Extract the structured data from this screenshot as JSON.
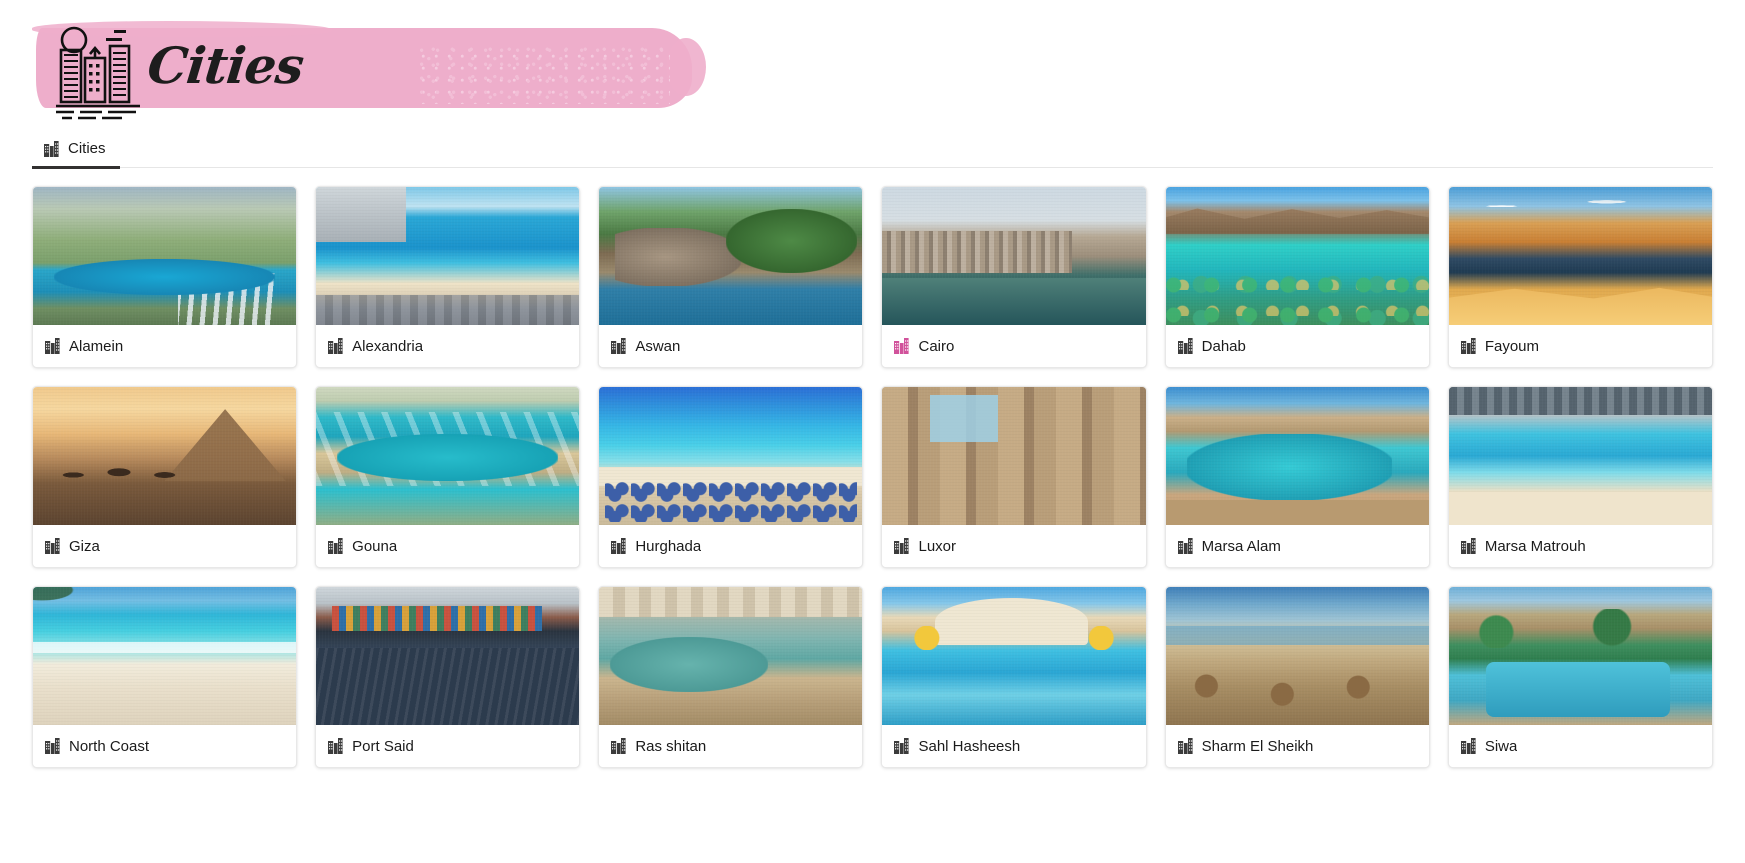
{
  "header": {
    "logo_text": "Cities",
    "logo_icon": "city-skyline-icon",
    "brush_color": "#eeaecb"
  },
  "tabs": [
    {
      "label": "Cities",
      "icon": "building-icon",
      "active": true
    }
  ],
  "accent_color": "#d1529b",
  "default_icon_color": "#3b3b3b",
  "grid": {
    "columns": 6,
    "cards": [
      {
        "name": "Alamein",
        "icon": "building-icon",
        "selected": false,
        "scene": "ph-alamein"
      },
      {
        "name": "Alexandria",
        "icon": "building-icon",
        "selected": false,
        "scene": "ph-alexandria"
      },
      {
        "name": "Aswan",
        "icon": "building-icon",
        "selected": false,
        "scene": "ph-aswan"
      },
      {
        "name": "Cairo",
        "icon": "building-icon",
        "selected": true,
        "scene": "ph-cairo"
      },
      {
        "name": "Dahab",
        "icon": "building-icon",
        "selected": false,
        "scene": "ph-dahab"
      },
      {
        "name": "Fayoum",
        "icon": "building-icon",
        "selected": false,
        "scene": "ph-fayoum"
      },
      {
        "name": "Giza",
        "icon": "building-icon",
        "selected": false,
        "scene": "ph-giza"
      },
      {
        "name": "Gouna",
        "icon": "building-icon",
        "selected": false,
        "scene": "ph-gouna"
      },
      {
        "name": "Hurghada",
        "icon": "building-icon",
        "selected": false,
        "scene": "ph-hurghada"
      },
      {
        "name": "Luxor",
        "icon": "building-icon",
        "selected": false,
        "scene": "ph-luxor"
      },
      {
        "name": "Marsa Alam",
        "icon": "building-icon",
        "selected": false,
        "scene": "ph-marsaalam"
      },
      {
        "name": "Marsa Matrouh",
        "icon": "building-icon",
        "selected": false,
        "scene": "ph-marsamatrouh"
      },
      {
        "name": "North Coast",
        "icon": "building-icon",
        "selected": false,
        "scene": "ph-northcoast"
      },
      {
        "name": "Port Said",
        "icon": "building-icon",
        "selected": false,
        "scene": "ph-portsaid"
      },
      {
        "name": "Ras shitan",
        "icon": "building-icon",
        "selected": false,
        "scene": "ph-rasshitan"
      },
      {
        "name": "Sahl Hasheesh",
        "icon": "building-icon",
        "selected": false,
        "scene": "ph-sahlhasheesh"
      },
      {
        "name": "Sharm El Sheikh",
        "icon": "building-icon",
        "selected": false,
        "scene": "ph-sharm"
      },
      {
        "name": "Siwa",
        "icon": "building-icon",
        "selected": false,
        "scene": "ph-siwa"
      }
    ]
  }
}
